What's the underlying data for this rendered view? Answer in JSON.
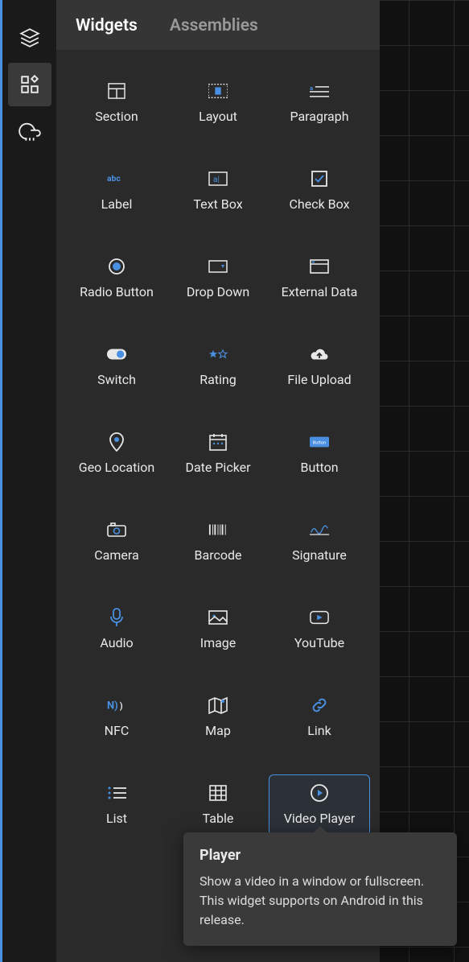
{
  "tabs": {
    "widgets": "Widgets",
    "assemblies": "Assemblies"
  },
  "widgets": [
    {
      "id": "section",
      "label": "Section"
    },
    {
      "id": "layout",
      "label": "Layout"
    },
    {
      "id": "paragraph",
      "label": "Paragraph"
    },
    {
      "id": "label",
      "label": "Label"
    },
    {
      "id": "textbox",
      "label": "Text Box"
    },
    {
      "id": "checkbox",
      "label": "Check Box"
    },
    {
      "id": "radio",
      "label": "Radio Button"
    },
    {
      "id": "dropdown",
      "label": "Drop Down"
    },
    {
      "id": "externaldata",
      "label": "External Data"
    },
    {
      "id": "switch",
      "label": "Switch"
    },
    {
      "id": "rating",
      "label": "Rating"
    },
    {
      "id": "fileupload",
      "label": "File Upload"
    },
    {
      "id": "geolocation",
      "label": "Geo Location"
    },
    {
      "id": "datepicker",
      "label": "Date Picker"
    },
    {
      "id": "button",
      "label": "Button"
    },
    {
      "id": "camera",
      "label": "Camera"
    },
    {
      "id": "barcode",
      "label": "Barcode"
    },
    {
      "id": "signature",
      "label": "Signature"
    },
    {
      "id": "audio",
      "label": "Audio"
    },
    {
      "id": "image",
      "label": "Image"
    },
    {
      "id": "youtube",
      "label": "YouTube"
    },
    {
      "id": "nfc",
      "label": "NFC"
    },
    {
      "id": "map",
      "label": "Map"
    },
    {
      "id": "link",
      "label": "Link"
    },
    {
      "id": "list",
      "label": "List"
    },
    {
      "id": "table",
      "label": "Table"
    },
    {
      "id": "videoplayer",
      "label": "Video Player"
    }
  ],
  "tooltip": {
    "title": "Player",
    "body": "Show a video in a window or fullscreen. This widget supports on Android in this release."
  }
}
